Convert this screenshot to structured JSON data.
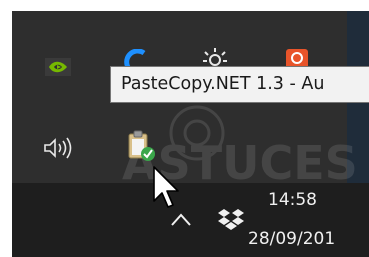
{
  "tooltip": {
    "text": "PasteCopy.NET 1.3 - Au"
  },
  "tray": {
    "overflow_icons": [
      "nvidia-icon",
      "app-blue-icon",
      "app-sun-icon",
      "app-orange-icon",
      "speaker-icon",
      "pastecopy-icon"
    ],
    "taskbar_icons": [
      "show-hidden-icons-chevron",
      "dropbox-icon"
    ]
  },
  "clock": {
    "time": "14:58",
    "date": "28/09/201"
  },
  "watermark": {
    "text": "ASTUCES"
  },
  "colors": {
    "flyout_bg": "#2e2e2e",
    "taskbar_bg": "#1e1e1e",
    "tooltip_bg": "#f2f2f2",
    "nvidia_green": "#76b900",
    "blue_app": "#1e90ff",
    "orange_app": "#e8542a"
  }
}
